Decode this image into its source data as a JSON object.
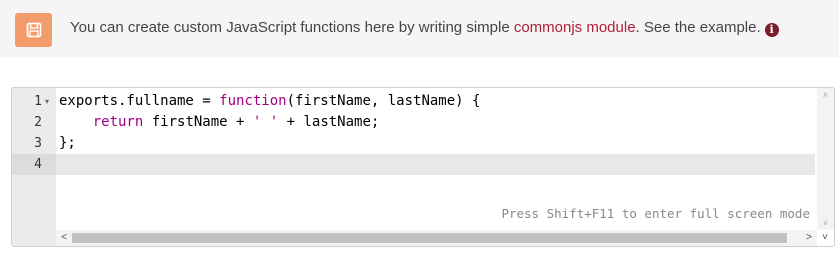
{
  "banner": {
    "text_before": "You can create custom JavaScript functions here by writing simple ",
    "link_text": "commonjs module",
    "text_after": ". See the example.",
    "info_glyph": "i",
    "save_icon": "floppy-disk-icon",
    "colors": {
      "icon_bg": "#f39c6b",
      "link": "#b01e38",
      "info": "#7a1f2a"
    }
  },
  "editor": {
    "line_numbers": [
      "1",
      "2",
      "3",
      "4"
    ],
    "fold_marker": "▾",
    "lines": {
      "l1": {
        "a": "exports.fullname = ",
        "b": "function",
        "c": "(firstName, lastName) {"
      },
      "l2": {
        "indent": "    ",
        "a": "return",
        "b": " firstName + ",
        "c": "' '",
        "d": " + lastName;"
      },
      "l3": {
        "a": "};"
      },
      "l4": {
        "a": ""
      }
    },
    "hint": "Press Shift+F11 to enter full screen mode",
    "scroll": {
      "up": "˄",
      "down": "˅",
      "left": "<",
      "right": ">"
    }
  }
}
